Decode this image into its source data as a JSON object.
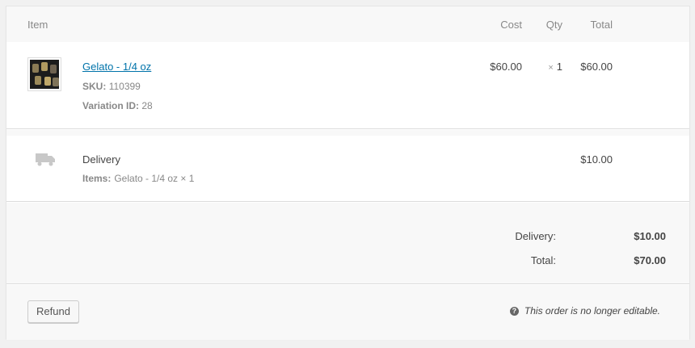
{
  "header": {
    "item": "Item",
    "cost": "Cost",
    "qty": "Qty",
    "total": "Total"
  },
  "line_item": {
    "name": "Gelato - 1/4 oz",
    "sku_label": "SKU:",
    "sku_value": "110399",
    "variation_label": "Variation ID:",
    "variation_value": "28",
    "cost": "$60.00",
    "qty_symbol": "×",
    "qty": "1",
    "total": "$60.00"
  },
  "shipping": {
    "name": "Delivery",
    "items_label": "Items:",
    "items_value": "Gelato - 1/4 oz × 1",
    "total": "$10.00",
    "icon": "truck-icon"
  },
  "totals": {
    "delivery_label": "Delivery:",
    "delivery_value": "$10.00",
    "total_label": "Total:",
    "total_value": "$70.00"
  },
  "footer": {
    "refund_label": "Refund",
    "help_icon_glyph": "?",
    "note": "This order is no longer editable."
  },
  "colors": {
    "link": "#0073aa",
    "panel_bg": "#ffffff",
    "section_bg": "#f8f8f8"
  }
}
